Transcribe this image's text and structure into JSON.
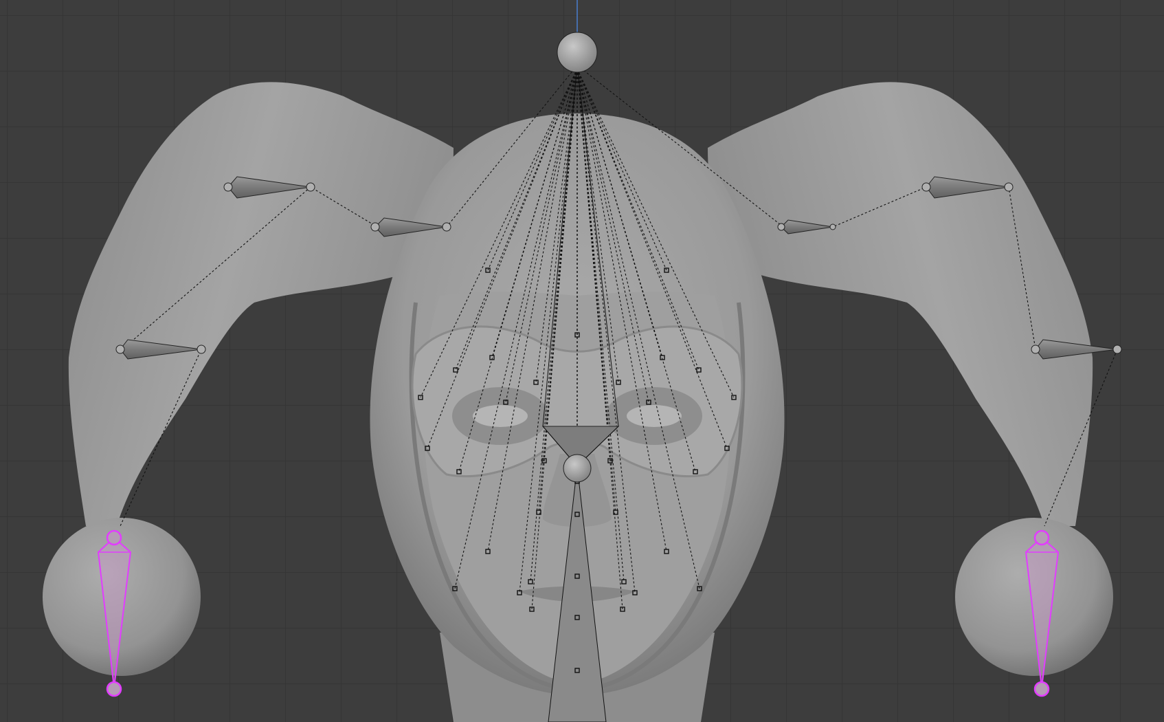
{
  "viewport": {
    "background": "#3d3d3d",
    "grid_color": "#353535",
    "axis_color": "#4a7fd0",
    "selected_color": "#e23cff"
  },
  "objects": [
    {
      "name": "jester-head-mesh",
      "type": "mesh",
      "color": "#9a9a9a"
    },
    {
      "name": "armature",
      "type": "armature"
    }
  ],
  "bones": [
    {
      "name": "head-control-sphere",
      "selected": false
    },
    {
      "name": "center-nose-bone",
      "selected": false
    },
    {
      "name": "hat-left-upper-bone",
      "selected": false
    },
    {
      "name": "hat-left-mid-bone",
      "selected": false
    },
    {
      "name": "hat-left-lower-bone",
      "selected": false
    },
    {
      "name": "hat-right-upper-bone",
      "selected": false
    },
    {
      "name": "hat-right-mid-bone",
      "selected": false
    },
    {
      "name": "hat-right-lower-bone",
      "selected": false
    },
    {
      "name": "bell-left-bone",
      "selected": true
    },
    {
      "name": "bell-right-bone",
      "selected": true
    }
  ],
  "face_control_points_count": 36
}
